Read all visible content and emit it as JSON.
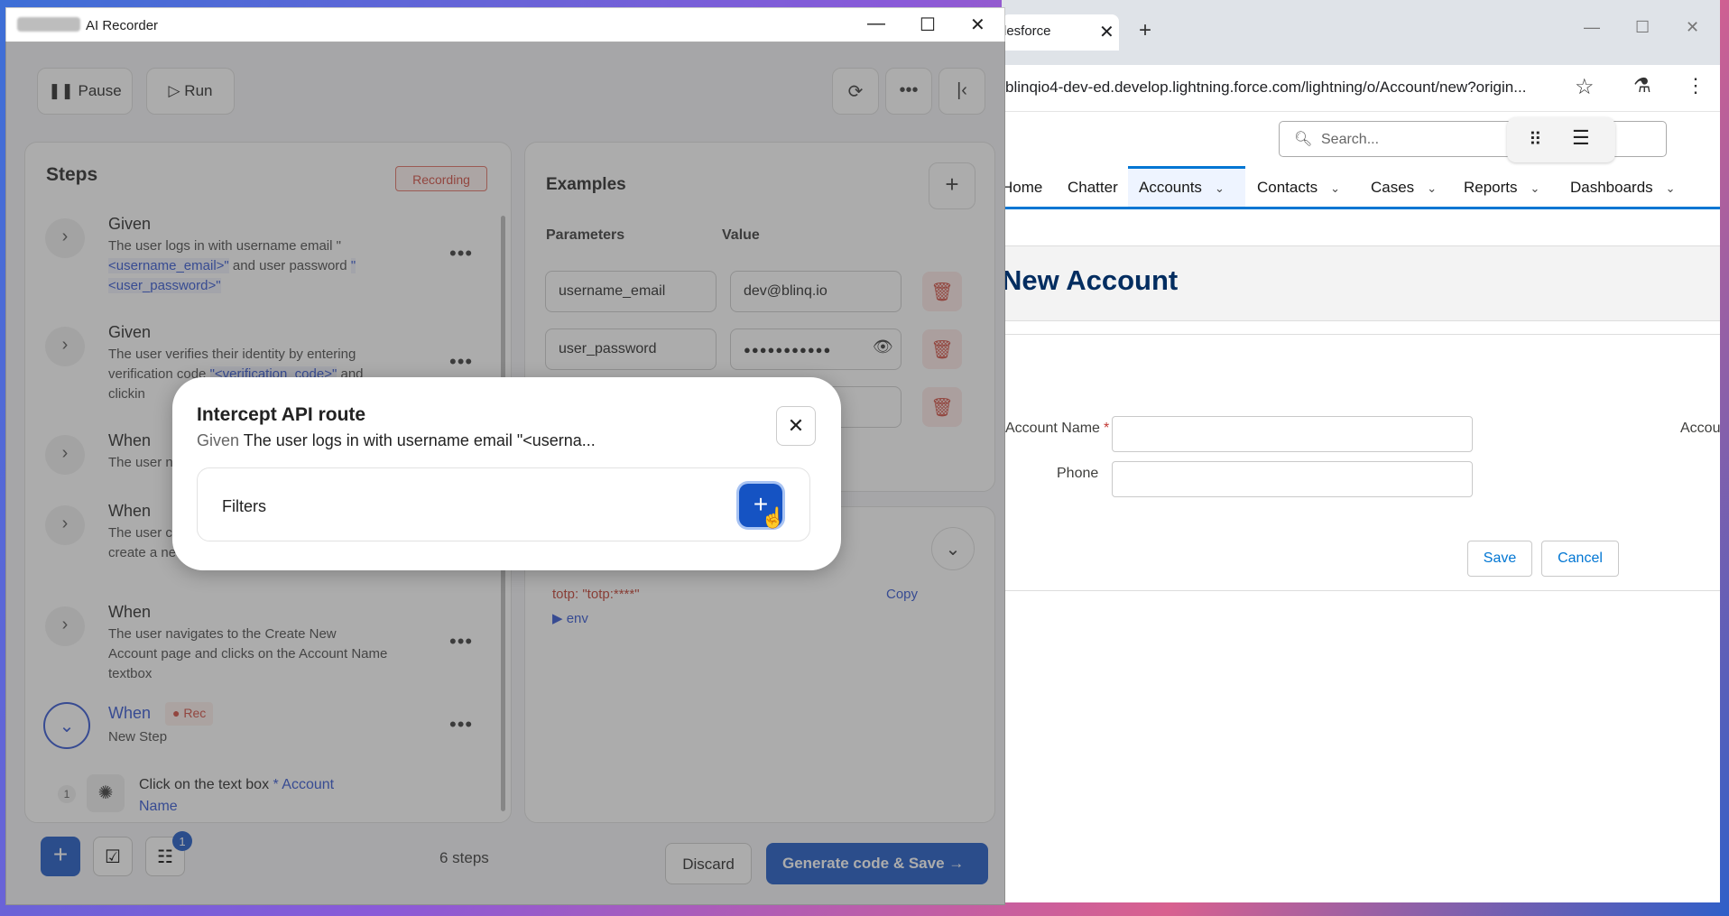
{
  "browser": {
    "tab_title": "lesforce",
    "tab_close": "✕",
    "new_tab": "+",
    "url": "blinqio4-dev-ed.develop.lightning.force.com/lightning/o/Account/new?origin...",
    "search_placeholder": "Search...",
    "nav": [
      {
        "label": "Home"
      },
      {
        "label": "Chatter"
      },
      {
        "label": "Accounts"
      },
      {
        "label": "Contacts"
      },
      {
        "label": "Cases"
      },
      {
        "label": "Reports"
      },
      {
        "label": "Dashboards"
      }
    ],
    "page_title": "New Account",
    "fields": {
      "account_name_label": "Account Name",
      "required_mark": "*",
      "phone_label": "Phone",
      "right_label": "Accou"
    },
    "buttons": {
      "save": "Save",
      "cancel": "Cancel"
    }
  },
  "recorder": {
    "title": "AI Recorder",
    "toolbar": {
      "pause": "Pause",
      "run": "Run"
    },
    "steps": {
      "title": "Steps",
      "status_badge": "Recording",
      "items": [
        {
          "keyword": "Given",
          "text_a": "The user logs in with username email \"",
          "var_a": "<username_email>\"",
          "text_b": " and user password ",
          "var_b": "\"<user_password>\""
        },
        {
          "keyword": "Given",
          "text_a": "The user verifies their identity by entering verification code ",
          "var_a": "\"<verification_code>\"",
          "text_b": " and clickin"
        },
        {
          "keyword": "When",
          "text_a": "The user n"
        },
        {
          "keyword": "When",
          "text_a": "The user c",
          "text_b": "create a ne"
        },
        {
          "keyword": "When",
          "text_a": "The user navigates to the Create New Account page and clicks on the Account Name textbox"
        },
        {
          "keyword": "When",
          "rec": "Rec",
          "text_a": "New Step"
        }
      ],
      "substep": {
        "index": "1",
        "text": "Click on the text box ",
        "target": "* Account Name"
      },
      "count": "6 steps",
      "badge_count": "1"
    },
    "examples": {
      "title": "Examples",
      "param_header": "Parameters",
      "value_header": "Value",
      "rows": [
        {
          "param": "username_email",
          "value": "dev@blinq.io"
        },
        {
          "param": "user_password",
          "value": "●●●●●●●●●●●"
        }
      ],
      "totp_line": "totp: \"totp:****\"",
      "copy": "Copy",
      "env": "▶ env"
    },
    "footer": {
      "discard": "Discard",
      "generate": "Generate code & Save"
    }
  },
  "modal": {
    "title": "Intercept API route",
    "sub_keyword": "Given",
    "sub_text": "The user logs in with username email \"<userna...",
    "filters_label": "Filters"
  }
}
